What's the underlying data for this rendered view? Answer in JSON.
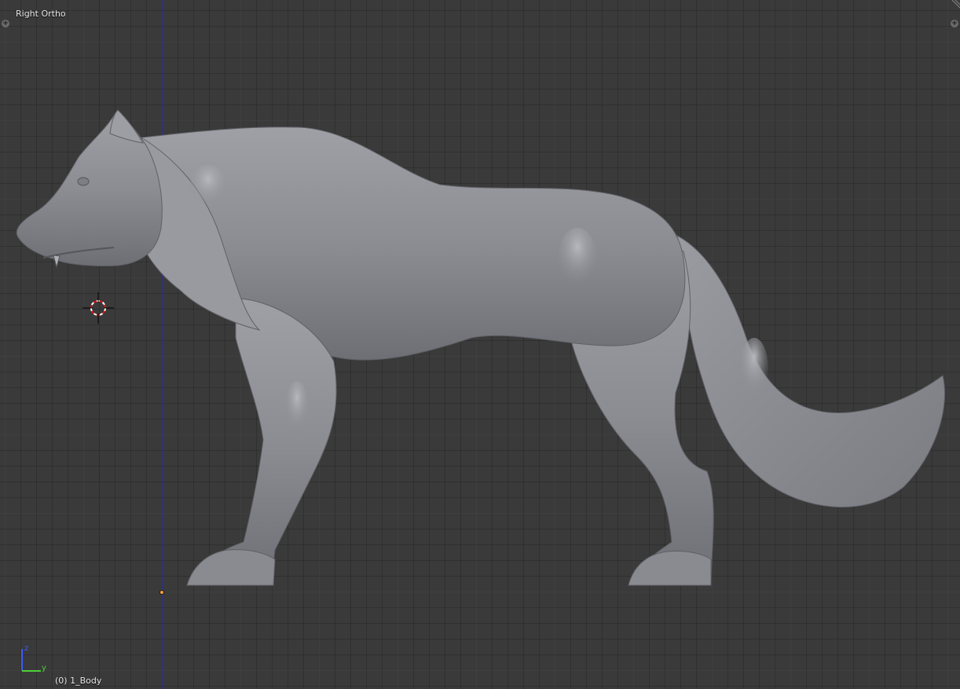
{
  "viewport": {
    "view_label": "Right Ortho",
    "object_label": "(0) 1_Body",
    "background_color": "#393939",
    "model_color": "#8e8f95"
  },
  "gizmo": {
    "z_label": "z",
    "y_label": "y",
    "z_color": "#3b5bff",
    "y_color": "#4fcf3a"
  },
  "corners": {
    "plus": "+"
  },
  "icons": {
    "cursor": "3d-cursor-icon",
    "origin": "origin-dot-icon",
    "widget_corner": "corner-drag-icon"
  }
}
